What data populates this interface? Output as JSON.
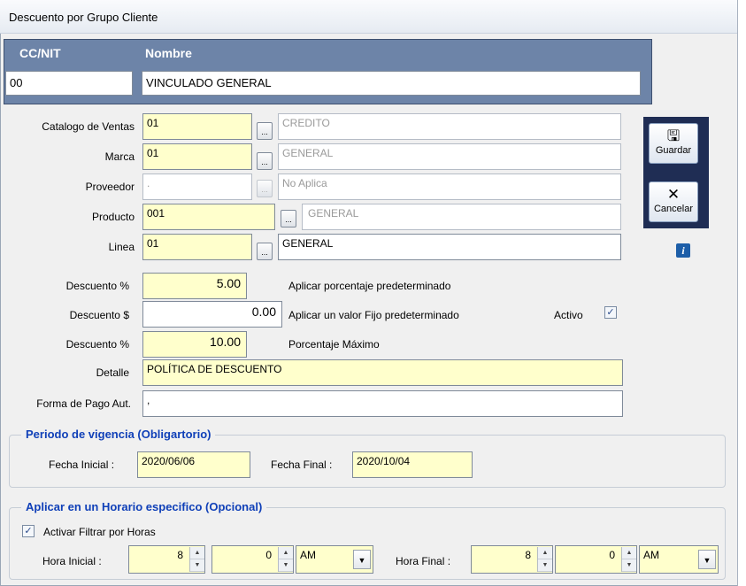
{
  "window": {
    "title": "Descuento por Grupo Cliente"
  },
  "header": {
    "cc_label": "CC/NIT",
    "nombre_label": "Nombre",
    "cc_value": "00",
    "nombre_value": "VINCULADO GENERAL"
  },
  "form": {
    "catalogo": {
      "label": "Catalogo de Ventas",
      "code": "01",
      "desc": "CREDITO"
    },
    "marca": {
      "label": "Marca",
      "code": "01",
      "desc": "GENERAL"
    },
    "proveedor": {
      "label": "Proveedor",
      "code": ".",
      "desc": "No Aplica"
    },
    "producto": {
      "label": "Producto",
      "code": "001",
      "desc": "GENERAL"
    },
    "linea": {
      "label": "Linea",
      "code": "01",
      "desc": "GENERAL"
    },
    "lookup_button": "...",
    "descuento_pct": {
      "label": "Descuento %",
      "value": "5.00",
      "note": "Aplicar porcentaje predeterminado"
    },
    "descuento_val": {
      "label": "Descuento $",
      "value": "0.00",
      "note": "Aplicar un valor Fijo predeterminado"
    },
    "activo": {
      "label": "Activo",
      "checked": true,
      "mark": "✓"
    },
    "descuento_max": {
      "label": "Descuento %",
      "value": "10.00",
      "note": "Porcentaje Máximo"
    },
    "detalle": {
      "label": "Detalle",
      "value": "POLÍTICA DE DESCUENTO"
    },
    "forma_pago": {
      "label": "Forma de Pago Aut.",
      "value": ","
    }
  },
  "actions": {
    "guardar": {
      "label": "Guardar",
      "icon": "save-icon",
      "glyph": "🖫"
    },
    "cancelar": {
      "label": "Cancelar",
      "icon": "cancel-icon",
      "glyph": "✕"
    },
    "info_glyph": "i"
  },
  "vigencia": {
    "title": "Periodo de vigencia  (Obligartorio)",
    "fecha_inicial_label": "Fecha Inicial :",
    "fecha_inicial": "2020/06/06",
    "fecha_final_label": "Fecha Final :",
    "fecha_final": "2020/10/04"
  },
  "horario": {
    "title": "Aplicar en un Horario  especifico  (Opcional)",
    "filtrar_label": "Activar Filtrar por Horas",
    "filtrar_checked": true,
    "check_mark": "✓",
    "hora_inicial_label": "Hora Inicial :",
    "hora_inicial_h": "8",
    "hora_inicial_m": "0",
    "hora_inicial_ampm": "AM",
    "hora_final_label": "Hora Final :",
    "hora_final_h": "8",
    "hora_final_m": "0",
    "hora_final_ampm": "AM",
    "spin_up": "▲",
    "spin_down": "▼",
    "dropdown_arrow": "▼"
  }
}
